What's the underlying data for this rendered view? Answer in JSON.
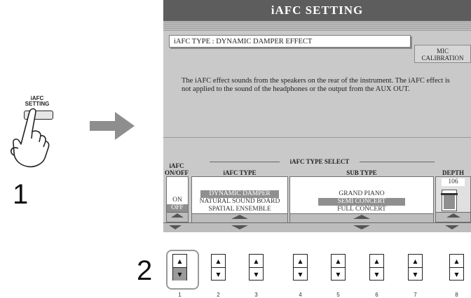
{
  "step1": {
    "number": "1",
    "button_label_line1": "iAFC",
    "button_label_line2": "SETTING"
  },
  "step2": {
    "number": "2"
  },
  "screen": {
    "title": "iAFC SETTING",
    "type_line": "iAFC TYPE : DYNAMIC DAMPER EFFECT",
    "mic_calibration_line1": "MIC",
    "mic_calibration_line2": "CALIBRATION",
    "description": "The iAFC effect sounds from the speakers on the rear of the instrument. The iAFC effect is not applied to the sound of the headphones or the output from the AUX OUT.",
    "group_label": "iAFC TYPE SELECT",
    "onoff": {
      "header_line1": "iAFC",
      "header_line2": "ON/OFF",
      "options": [
        "ON",
        "OFF"
      ],
      "selected": "OFF"
    },
    "iafc_type": {
      "header": "iAFC TYPE",
      "options": [
        "DYNAMIC DAMPER",
        "NATURAL SOUND BOARD",
        "SPATIAL ENSEMBLE"
      ],
      "selected": "DYNAMIC DAMPER"
    },
    "sub_type": {
      "header": "SUB TYPE",
      "options": [
        "GRAND PIANO",
        "SEMI CONCERT",
        "FULL CONCERT"
      ],
      "selected": "SEMI CONCERT"
    },
    "depth": {
      "header": "DEPTH",
      "value": "106"
    }
  },
  "panel_buttons": {
    "count": 8,
    "numbers": [
      "1",
      "2",
      "3",
      "4",
      "5",
      "6",
      "7",
      "8"
    ],
    "pressed": "1"
  },
  "icons": {
    "hand": "pointing-hand-icon",
    "arrow": "right-arrow-icon"
  }
}
